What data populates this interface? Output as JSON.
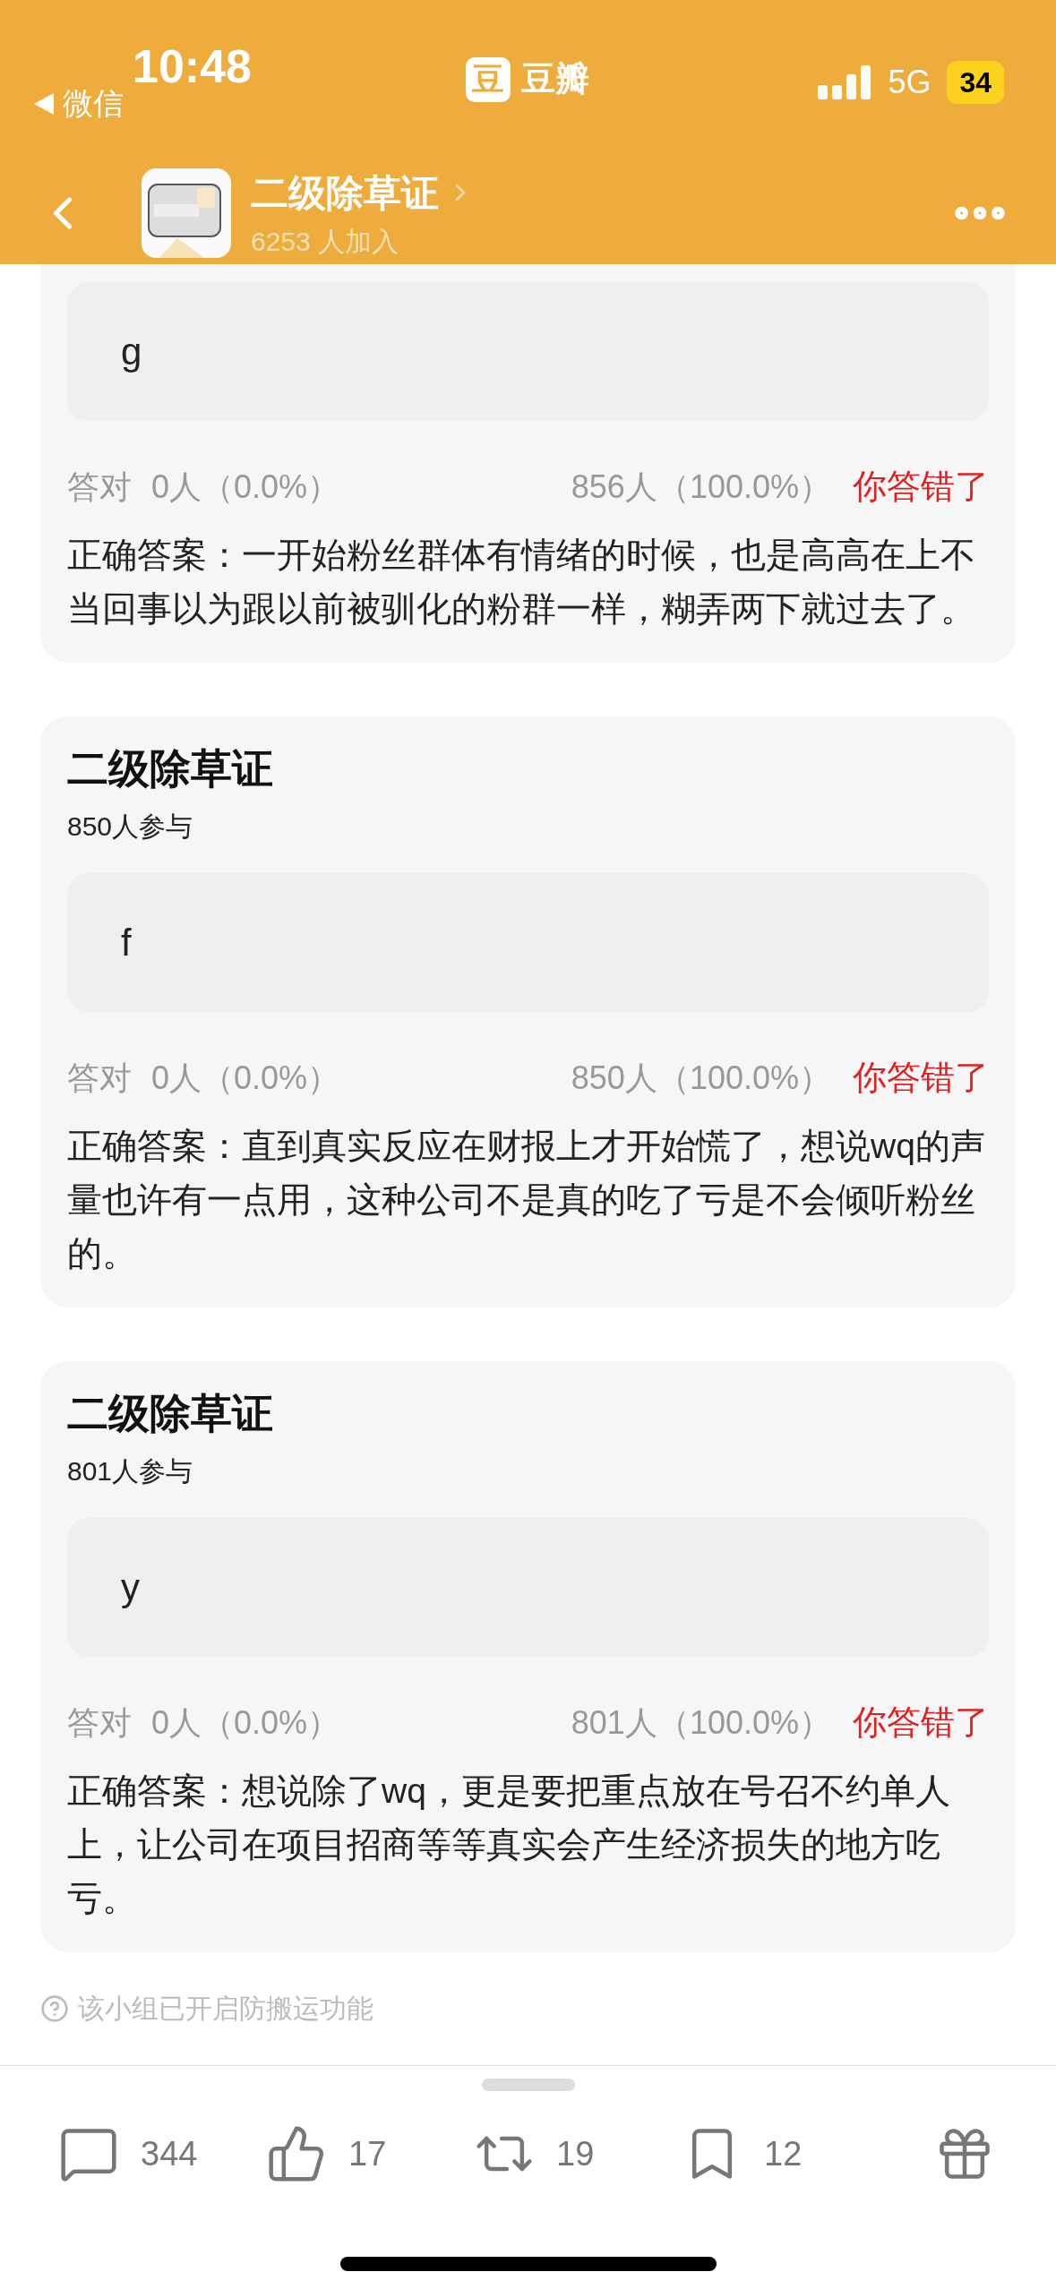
{
  "status_bar": {
    "time": "10:48",
    "back_app": "微信",
    "app_logo": "豆",
    "app_name": "豆瓣",
    "network": "5G",
    "battery": "34"
  },
  "header": {
    "title": "二级除草证",
    "members": "6253 人加入"
  },
  "cards": [
    {
      "option": "g",
      "correct_label": "答对",
      "correct_count": "0人（0.0%）",
      "wrong_count": "856人（100.0%）",
      "result": "你答错了",
      "answered_correctly": false,
      "answer": "正确答案：一开始粉丝群体有情绪的时候，也是高高在上不当回事以为跟以前被驯化的粉群一样，糊弄两下就过去了。"
    },
    {
      "title": "二级除草证",
      "participants": "850人参与",
      "option": "f",
      "correct_label": "答对",
      "correct_count": "0人（0.0%）",
      "wrong_count": "850人（100.0%）",
      "result": "你答错了",
      "answered_correctly": false,
      "answer": "正确答案：直到真实反应在财报上才开始慌了，想说wq的声量也许有一点用，这种公司不是真的吃了亏是不会倾听粉丝的。"
    },
    {
      "title": "二级除草证",
      "participants": "801人参与",
      "option": "y",
      "correct_label": "答对",
      "correct_count": "0人（0.0%）",
      "wrong_count": "801人（100.0%）",
      "result": "你答错了",
      "answered_correctly": false,
      "answer": "正确答案：想说除了wq，更是要把重点放在号召不约单人上，让公司在项目招商等等真实会产生经济损失的地方吃亏。"
    }
  ],
  "notice": "该小组已开启防搬运功能",
  "actions": [
    {
      "kind": "comment",
      "count": "344"
    },
    {
      "kind": "like",
      "count": "17"
    },
    {
      "kind": "repost",
      "count": "19"
    },
    {
      "kind": "bookmark",
      "count": "12"
    },
    {
      "kind": "gift"
    }
  ]
}
